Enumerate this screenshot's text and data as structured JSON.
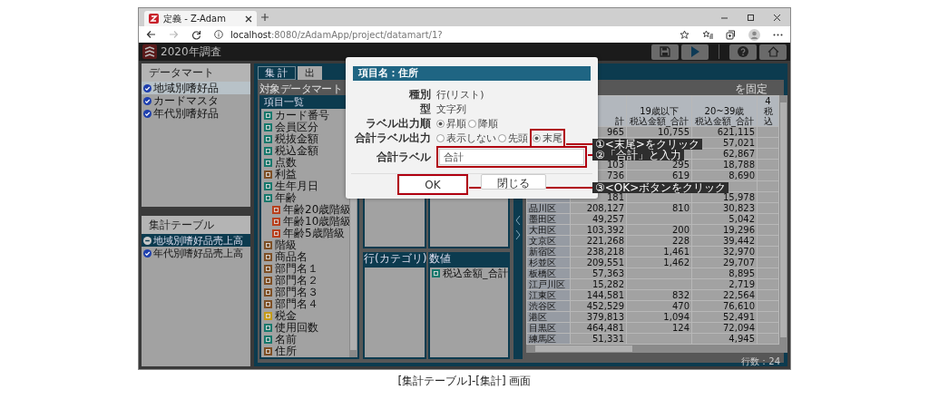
{
  "browser": {
    "tab_title": "定義 - Z-Adam",
    "url": "**localhost**:8080/zAdamApp/project/datamart/1?"
  },
  "app": {
    "title": "2020年調査"
  },
  "datamart_panel": {
    "title": "データマート",
    "items": [
      {
        "label": "地域別嗜好品",
        "selected": true
      },
      {
        "label": "カードマスタ",
        "selected": false
      },
      {
        "label": "年代別嗜好品",
        "selected": false
      }
    ]
  },
  "table_panel": {
    "title": "集計テーブル",
    "items": [
      {
        "label": "地域別嗜好品売上高",
        "selected": true
      },
      {
        "label": "年代別嗜好品売上高",
        "selected": false
      }
    ]
  },
  "tabs": [
    {
      "label": "集 計",
      "selected": true
    },
    {
      "label": "出",
      "selected": false
    }
  ],
  "target_label": "対象データマート",
  "field_list": {
    "title": "項目一覧",
    "items": [
      {
        "label": "カード番号",
        "kind": "number"
      },
      {
        "label": "会員区分",
        "kind": "number"
      },
      {
        "label": "税抜金額",
        "kind": "number"
      },
      {
        "label": "税込金額",
        "kind": "number"
      },
      {
        "label": "点数",
        "kind": "number"
      },
      {
        "label": "利益",
        "kind": "text"
      },
      {
        "label": "生年月日",
        "kind": "number"
      },
      {
        "label": "年齢",
        "kind": "number",
        "children": [
          {
            "label": "年齢20歳階級",
            "kind": "category"
          },
          {
            "label": "年齢10歳階級",
            "kind": "category"
          },
          {
            "label": "年齢5歳階級",
            "kind": "category"
          }
        ]
      },
      {
        "label": "階級",
        "kind": "text"
      },
      {
        "label": "商品名",
        "kind": "text"
      },
      {
        "label": "部門名１",
        "kind": "text"
      },
      {
        "label": "部門名２",
        "kind": "text"
      },
      {
        "label": "部門名３",
        "kind": "text"
      },
      {
        "label": "部門名４",
        "kind": "text"
      },
      {
        "label": "税金",
        "kind": "calc"
      },
      {
        "label": "使用回数",
        "kind": "number"
      },
      {
        "label": "名前",
        "kind": "number"
      },
      {
        "label": "住所",
        "kind": "text"
      }
    ]
  },
  "row_category": {
    "title": "行(カテゴリ)"
  },
  "values": {
    "title": "数値",
    "items": [
      {
        "label": "税込金額_合計",
        "kind": "number"
      }
    ]
  },
  "table": {
    "freeze_label": "を固定",
    "columns": [
      {
        "lines": [
          "計"
        ]
      },
      {
        "lines": [
          "19歳以下",
          "税込金額_合計"
        ]
      },
      {
        "lines": [
          "20~39歳",
          "税込金額_合計"
        ]
      },
      {
        "lines": [
          "4",
          "税込"
        ]
      }
    ],
    "rows": [
      {
        "col_1": "965",
        "col_2": "10,755",
        "col_3": "621,115"
      },
      {
        "col_3": "57,021"
      },
      {
        "col_3": "62,867"
      },
      {
        "col_1": "103",
        "col_2": "295",
        "col_3": "18,788"
      },
      {
        "col_1": "736",
        "col_2": "619",
        "col_3": "8,690"
      },
      {},
      {
        "col_1": "181",
        "col_3": "15,978"
      },
      {
        "label": "品川区",
        "col_1": "208,127",
        "col_2": "810",
        "col_3": "30,823"
      },
      {
        "label": "墨田区",
        "col_1": "49,257",
        "col_3": "5,042"
      },
      {
        "label": "大田区",
        "col_1": "103,392",
        "col_2": "200",
        "col_3": "19,296"
      },
      {
        "label": "文京区",
        "col_1": "221,268",
        "col_2": "228",
        "col_3": "39,442"
      },
      {
        "label": "新宿区",
        "col_1": "238,218",
        "col_2": "1,461",
        "col_3": "32,970"
      },
      {
        "label": "杉並区",
        "col_1": "209,551",
        "col_2": "1,462",
        "col_3": "29,707"
      },
      {
        "label": "板橋区",
        "col_1": "57,363",
        "col_3": "8,895"
      },
      {
        "label": "江戸川区",
        "col_1": "15,282",
        "col_3": "2,719"
      },
      {
        "label": "江東区",
        "col_1": "144,581",
        "col_2": "832",
        "col_3": "22,564"
      },
      {
        "label": "渋谷区",
        "col_1": "452,529",
        "col_2": "470",
        "col_3": "76,610"
      },
      {
        "label": "港区",
        "col_1": "379,813",
        "col_2": "1,094",
        "col_3": "52,491"
      },
      {
        "label": "目黒区",
        "col_1": "464,481",
        "col_2": "124",
        "col_3": "72,094"
      },
      {
        "label": "練馬区",
        "col_1": "51,331",
        "col_3": "4,945"
      }
    ],
    "row_count": "行数：24"
  },
  "dialog": {
    "title": "項目名：住所",
    "fields": [
      {
        "kind": "text",
        "label": "種別",
        "value": "行(リスト)"
      },
      {
        "kind": "text",
        "label": "型",
        "value": "文字列"
      },
      {
        "kind": "radio",
        "label": "ラベル出力順",
        "options": [
          {
            "label": "昇順",
            "selected": true,
            "highlighted": false
          },
          {
            "label": "降順",
            "selected": false,
            "highlighted": false
          }
        ]
      },
      {
        "kind": "radio",
        "label": "合計ラベル出力",
        "options": [
          {
            "label": "表示しない",
            "selected": false,
            "highlighted": false
          },
          {
            "label": "先頭",
            "selected": false,
            "highlighted": false
          },
          {
            "label": "末尾",
            "selected": true,
            "highlighted": true
          }
        ]
      },
      {
        "kind": "input",
        "label": "合計ラベル",
        "value": "合計",
        "highlighted": true
      }
    ],
    "buttons": [
      {
        "label": "OK",
        "highlighted": true
      },
      {
        "label": "閉じる",
        "highlighted": false
      }
    ]
  },
  "annotations": [
    {
      "text": "①<末尾>をクリック"
    },
    {
      "text": "②「合計」と入力"
    },
    {
      "text": "③<OK>ボタンをクリック"
    }
  ],
  "caption": "[集計テーブル]-[集計] 画面"
}
